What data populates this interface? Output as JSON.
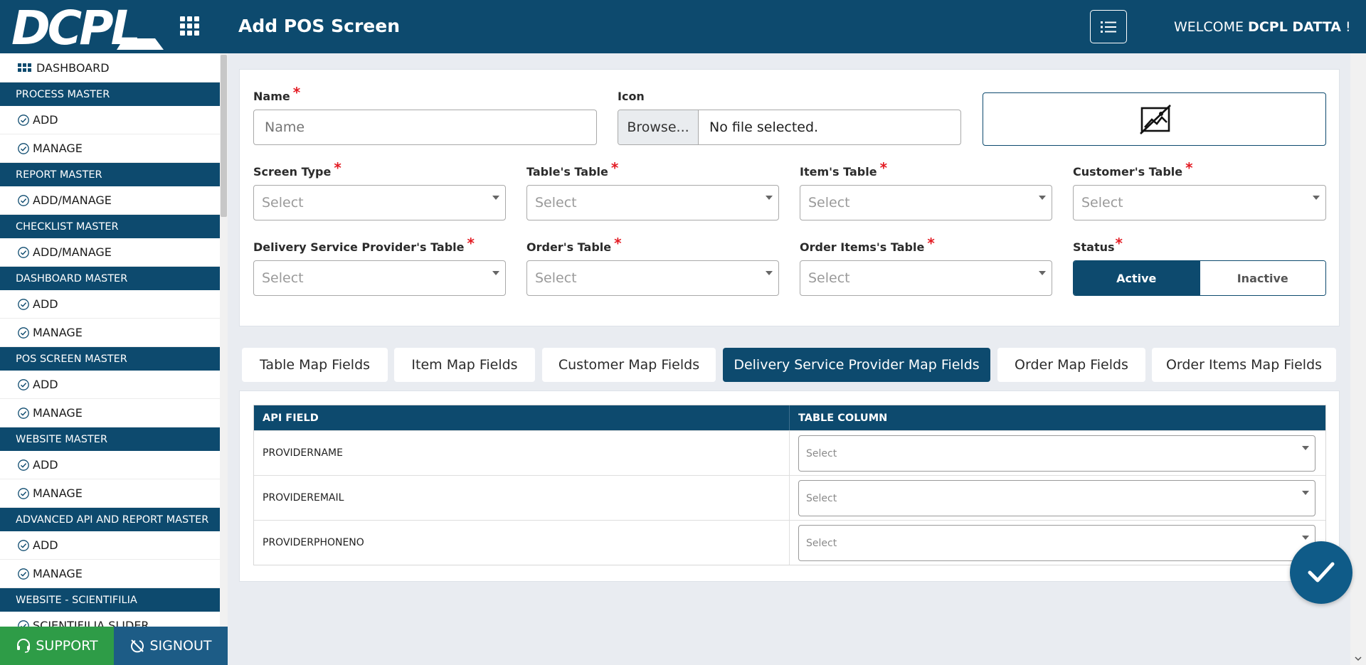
{
  "header": {
    "logo_text": "DCPL",
    "page_title": "Add POS Screen",
    "welcome_prefix": "WELCOME",
    "user_name": "DCPL DATTA",
    "welcome_suffix": "!"
  },
  "sidebar": {
    "dashboard_label": "DASHBOARD",
    "sections": [
      {
        "title": "PROCESS MASTER",
        "items": [
          "ADD",
          "MANAGE"
        ]
      },
      {
        "title": "REPORT MASTER",
        "items": [
          "ADD/MANAGE"
        ]
      },
      {
        "title": "CHECKLIST MASTER",
        "items": [
          "ADD/MANAGE"
        ]
      },
      {
        "title": "DASHBOARD MASTER",
        "items": [
          "ADD",
          "MANAGE"
        ]
      },
      {
        "title": "POS SCREEN MASTER",
        "items": [
          "ADD",
          "MANAGE"
        ]
      },
      {
        "title": "WEBSITE MASTER",
        "items": [
          "ADD",
          "MANAGE"
        ]
      },
      {
        "title": "ADVANCED API AND REPORT MASTER",
        "items": [
          "ADD",
          "MANAGE"
        ]
      },
      {
        "title": "WEBSITE - SCIENTIFILIA",
        "items": [
          "SCIENTIFILIA SLIDER"
        ]
      }
    ],
    "support_label": "SUPPORT",
    "signout_label": "SIGNOUT"
  },
  "form": {
    "name": {
      "label": "Name",
      "placeholder": "Name",
      "value": ""
    },
    "icon": {
      "label": "Icon",
      "browse_label": "Browse...",
      "file_text": "No file selected."
    },
    "screen_type": {
      "label": "Screen Type",
      "value": "Select"
    },
    "tables_table": {
      "label": "Table's Table",
      "value": "Select"
    },
    "items_table": {
      "label": "Item's Table",
      "value": "Select"
    },
    "customers_table": {
      "label": "Customer's Table",
      "value": "Select"
    },
    "dsp_table": {
      "label": "Delivery Service Provider's Table",
      "value": "Select"
    },
    "orders_table": {
      "label": "Order's Table",
      "value": "Select"
    },
    "order_items_table": {
      "label": "Order Items's Table",
      "value": "Select"
    },
    "status": {
      "label": "Status",
      "active_label": "Active",
      "inactive_label": "Inactive",
      "selected": "Active"
    },
    "required_mark": "*"
  },
  "tabs": [
    {
      "label": "Table Map Fields",
      "active": false
    },
    {
      "label": "Item Map Fields",
      "active": false
    },
    {
      "label": "Customer Map Fields",
      "active": false
    },
    {
      "label": "Delivery Service Provider Map Fields",
      "active": true
    },
    {
      "label": "Order Map Fields",
      "active": false
    },
    {
      "label": "Order Items Map Fields",
      "active": false
    }
  ],
  "mapping_table": {
    "headers": [
      "API FIELD",
      "TABLE COLUMN"
    ],
    "rows": [
      {
        "api_field": "PROVIDERNAME",
        "column": "Select"
      },
      {
        "api_field": "PROVIDEREMAIL",
        "column": "Select"
      },
      {
        "api_field": "PROVIDERPHONENO",
        "column": "Select"
      }
    ]
  },
  "colors": {
    "primary": "#0d4a6e",
    "support_green": "#2e9c47",
    "signout_blue": "#1d5c86",
    "required_red": "#e31b23",
    "background": "#e9ecf1"
  },
  "icons": {
    "menu": "apps-grid-icon",
    "list": "list-icon",
    "preview": "image-placeholder-icon",
    "item": "check-circle-icon",
    "support": "headset-icon",
    "signout": "signout-icon",
    "submit": "checkmark-icon"
  }
}
